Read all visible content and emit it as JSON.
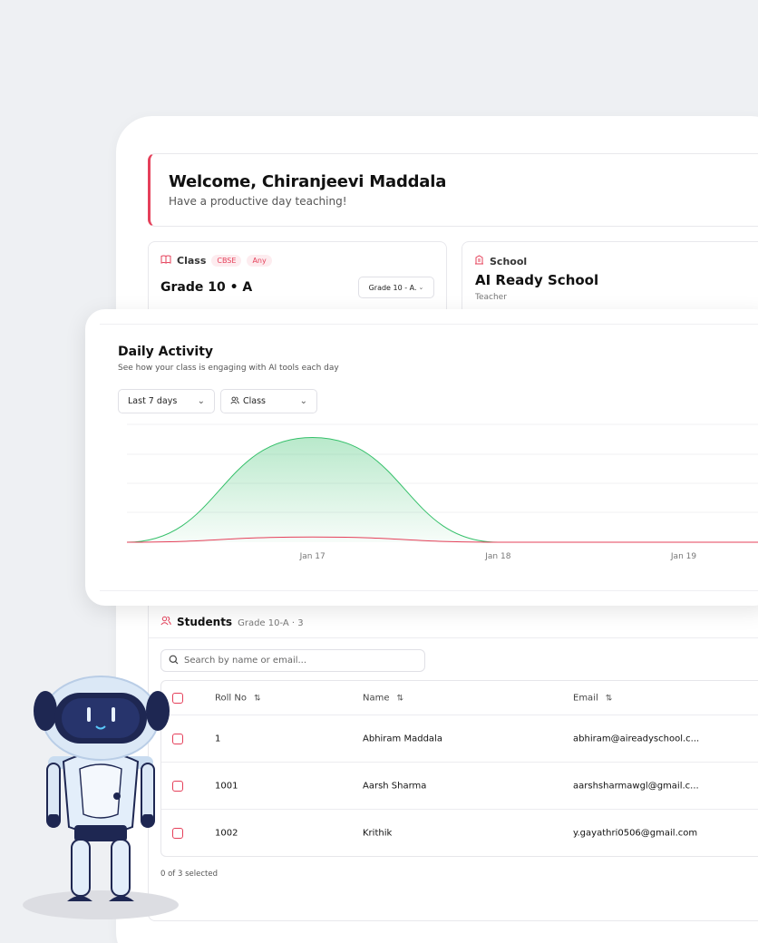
{
  "welcome": {
    "title": "Welcome, Chiranjeevi Maddala",
    "subtitle": "Have a productive day teaching!"
  },
  "class_card": {
    "label": "Class",
    "badges": [
      "CBSE",
      "Any"
    ],
    "class_name": "Grade 10 • A",
    "select_value": "Grade 10 - A."
  },
  "school_card": {
    "label": "School",
    "name": "AI Ready School",
    "role": "Teacher"
  },
  "activity": {
    "title": "Daily Activity",
    "subtitle": "See how your class is engaging with AI tools each day",
    "range_select": "Last 7 days",
    "class_select": "Class"
  },
  "chart_data": {
    "type": "area",
    "title": "",
    "x_ticks": [
      "Jan 17",
      "Jan 18",
      "Jan 19"
    ],
    "x_domain": [
      "Jan 16",
      "Jan 20"
    ],
    "series": [
      {
        "color": "#35c06a",
        "points": [
          [
            "Jan 16",
            0
          ],
          [
            "Jan 17",
            4
          ],
          [
            "Jan 18",
            0
          ],
          [
            "Jan 19",
            0
          ],
          [
            "Jan 20",
            0
          ]
        ]
      },
      {
        "color": "#e5405a",
        "points": [
          [
            "Jan 16",
            0
          ],
          [
            "Jan 17",
            0.2
          ],
          [
            "Jan 18",
            0
          ],
          [
            "Jan 19",
            0
          ],
          [
            "Jan 20",
            0
          ]
        ]
      }
    ],
    "ylim": [
      0,
      4.5
    ],
    "grid": true
  },
  "students": {
    "title": "Students",
    "meta": "Grade 10-A · 3",
    "search_placeholder": "Search by name or email...",
    "columns": [
      "Roll No",
      "Name",
      "Email"
    ],
    "rows": [
      {
        "roll": "1",
        "name": "Abhiram Maddala",
        "email": "abhiram@aireadyschool.c..."
      },
      {
        "roll": "1001",
        "name": "Aarsh Sharma",
        "email": "aarshsharmawgl@gmail.c..."
      },
      {
        "roll": "1002",
        "name": "Krithik",
        "email": "y.gayathri0506@gmail.com"
      }
    ],
    "selected_text": "0 of 3 selected"
  },
  "colors": {
    "accent": "#e5405a",
    "green": "#35c06a"
  },
  "icons": {
    "class": "book-icon",
    "school": "building-icon",
    "students": "users-icon",
    "search": "search-icon",
    "sort": "sort-icon"
  }
}
